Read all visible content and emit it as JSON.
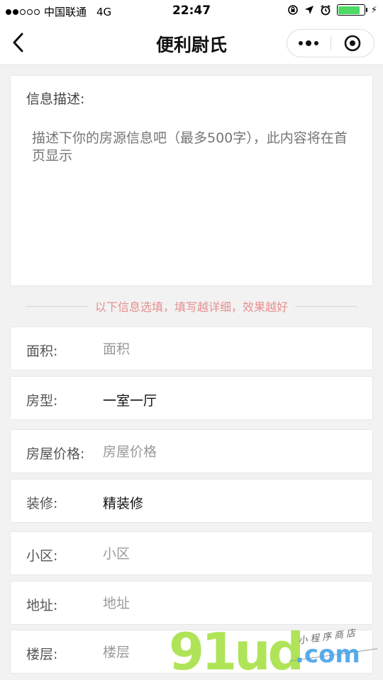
{
  "status_bar": {
    "signal_full": 2,
    "signal_total": 5,
    "carrier": "中国联通",
    "network": "4G",
    "time": "22:47",
    "battery_level": 0.85,
    "battery_color": "#4cd964"
  },
  "navbar": {
    "title": "便利尉氏",
    "back_icon": "chevron-left-icon",
    "more_icon": "more-dots-icon",
    "close_icon": "target-icon"
  },
  "description": {
    "label": "信息描述:",
    "placeholder": "描述下你的房源信息吧（最多500字），此内容将在首页显示"
  },
  "hint": {
    "text": "以下信息选填，填写越详细，效果越好",
    "color": "#e78f8f"
  },
  "fields": [
    {
      "label": "面积:",
      "placeholder": "面积"
    },
    {
      "label": "房型:",
      "value": "一室一厅"
    },
    {
      "label": "房屋价格:",
      "placeholder": "房屋价格"
    },
    {
      "label": "装修:",
      "value": "精装修"
    },
    {
      "label": "小区:",
      "placeholder": "小区"
    },
    {
      "label": "地址:",
      "placeholder": "地址"
    },
    {
      "label": "楼层:",
      "placeholder": "楼层"
    }
  ],
  "watermark": {
    "brand": "91ud",
    "domain": ".com",
    "subtitle": "小程序商店"
  }
}
